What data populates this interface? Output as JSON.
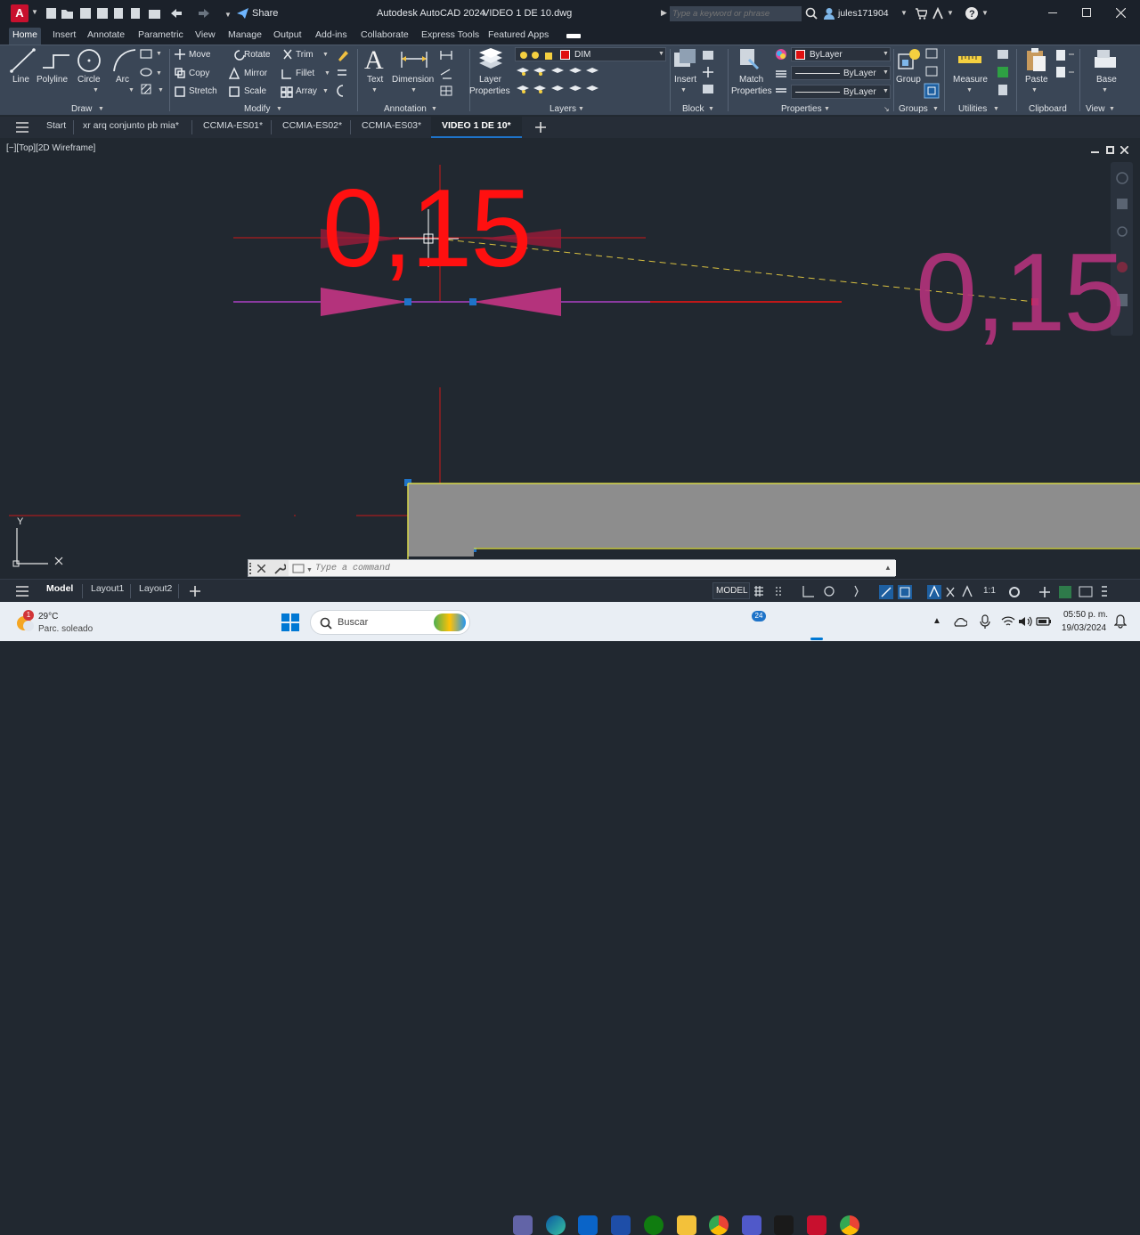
{
  "app": {
    "title": "Autodesk AutoCAD 2024",
    "file_title": "VIDEO 1 DE 10.dwg",
    "share_label": "Share",
    "search_placeholder": "Type a keyword or phrase",
    "user": "jules171904",
    "logo_letter": "A"
  },
  "ribbon_tabs": [
    "Home",
    "Insert",
    "Annotate",
    "Parametric",
    "View",
    "Manage",
    "Output",
    "Add-ins",
    "Collaborate",
    "Express Tools",
    "Featured Apps"
  ],
  "active_ribbon_tab": "Home",
  "draw": {
    "line": "Line",
    "polyline": "Polyline",
    "circle": "Circle",
    "arc": "Arc",
    "group": "Draw"
  },
  "modify": {
    "move": "Move",
    "rotate": "Rotate",
    "trim": "Trim",
    "copy": "Copy",
    "mirror": "Mirror",
    "fillet": "Fillet",
    "stretch": "Stretch",
    "scale": "Scale",
    "array": "Array",
    "group": "Modify"
  },
  "annotation": {
    "text": "Text",
    "dimension": "Dimension",
    "group": "Annotation"
  },
  "layers": {
    "layer_properties_1": "Layer",
    "layer_properties_2": "Properties",
    "current_layer": "DIM",
    "group": "Layers"
  },
  "block": {
    "insert": "Insert",
    "group": "Block"
  },
  "properties": {
    "match_1": "Match",
    "match_2": "Properties",
    "color": "ByLayer",
    "linetype": "ByLayer",
    "lineweight": "ByLayer",
    "group": "Properties"
  },
  "groups": {
    "group": "Group",
    "group_label": "Groups"
  },
  "utilities": {
    "measure": "Measure",
    "group": "Utilities"
  },
  "clipboard": {
    "paste": "Paste",
    "group": "Clipboard"
  },
  "view": {
    "base": "Base",
    "group": "View"
  },
  "file_tabs": [
    "Start",
    "xr arq conjunto pb mia*",
    "CCMIA-ES01*",
    "CCMIA-ES02*",
    "CCMIA-ES03*",
    "VIDEO 1 DE 10*"
  ],
  "viewport": {
    "label": "[−][Top][2D Wireframe]",
    "dim_text_main": "0,15",
    "dim_text_ghost": "0,15",
    "ucs_y": "Y",
    "ucs_x": "X"
  },
  "command_line": {
    "placeholder": "Type a command"
  },
  "layout_tabs": [
    "Model",
    "Layout1",
    "Layout2"
  ],
  "status": {
    "model": "MODEL",
    "scale": "1:1"
  },
  "taskbar": {
    "temp": "29°C",
    "weather": "Parc. soleado",
    "search": "Buscar",
    "badge_weather": "1",
    "badge_teams": "24",
    "time": "05:50 p. m.",
    "date": "19/03/2024"
  },
  "colors": {
    "accent": "#1e73c8",
    "dim_red": "#ff1a1a",
    "dim_magenta": "#b4337c",
    "yellow": "#d8d84a"
  }
}
